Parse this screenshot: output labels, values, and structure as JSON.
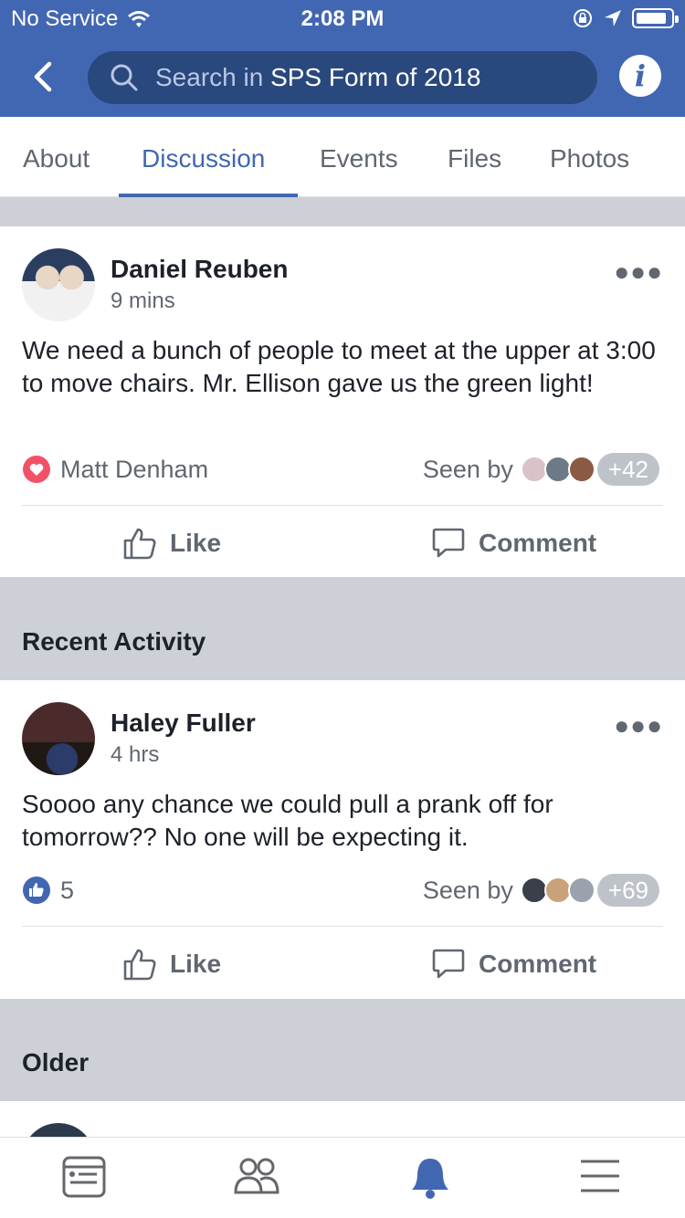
{
  "status": {
    "carrier": "No Service",
    "time": "2:08 PM"
  },
  "search": {
    "prefix": "Search in ",
    "group": "SPS Form of 2018"
  },
  "tabs": [
    {
      "label": "About"
    },
    {
      "label": "Discussion"
    },
    {
      "label": "Events"
    },
    {
      "label": "Files"
    },
    {
      "label": "Photos"
    }
  ],
  "posts": [
    {
      "author": "Daniel Reuben",
      "time": "9 mins",
      "text": "We need a bunch of people to meet at the upper at 3:00 to move chairs. Mr. Ellison gave us the green light!",
      "reaction_icon": "heart-icon",
      "reactions": "Matt Denham",
      "seen_label": "Seen by",
      "seen_more": "+42",
      "like_label": "Like",
      "comment_label": "Comment"
    },
    {
      "author": "Haley Fuller",
      "time": "4 hrs",
      "text": "Soooo any chance we could pull a prank off for tomorrow?? No one will be expecting it.",
      "reaction_icon": "thumbs-up-icon",
      "reactions": "5",
      "seen_label": "Seen by",
      "seen_more": "+69",
      "like_label": "Like",
      "comment_label": "Comment"
    }
  ],
  "sections": {
    "recent": "Recent Activity",
    "older": "Older"
  },
  "colors": {
    "brand": "#4267b2",
    "search_bg": "#29487d",
    "heart": "#f25268",
    "feed_bg": "#cdd0d6"
  },
  "bottom_nav": [
    "news-feed-icon",
    "groups-icon",
    "notifications-icon",
    "menu-icon"
  ]
}
